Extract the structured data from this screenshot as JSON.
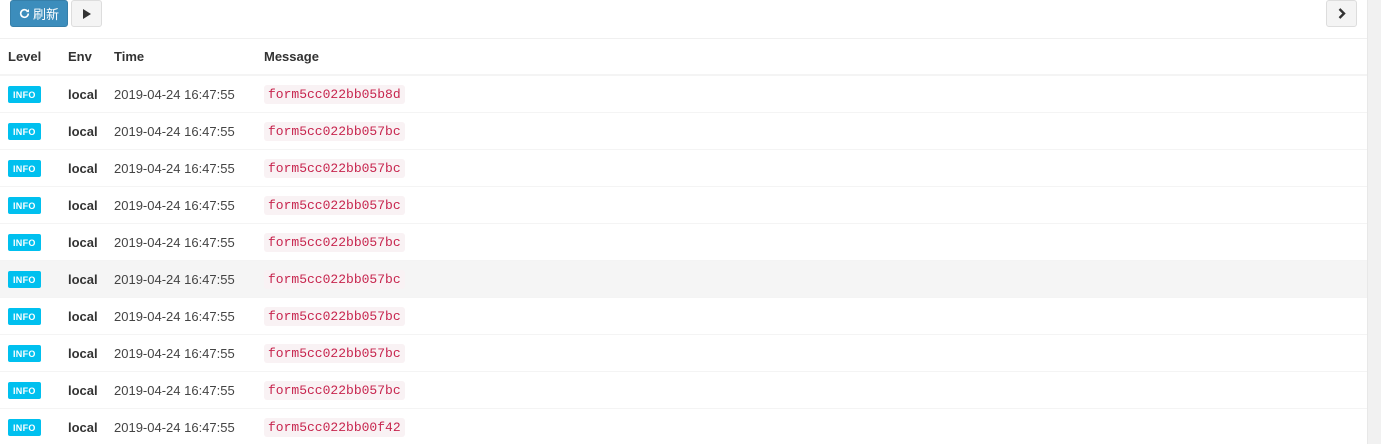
{
  "toolbar": {
    "refresh_label": "刷新",
    "refresh_icon": "refresh-icon",
    "play_icon": "play-icon",
    "next_icon": "chevron-right-icon"
  },
  "colors": {
    "primary": "#3c8dbc",
    "info_badge": "#00c0ef",
    "code_text": "#c7254e",
    "code_bg": "#f9f2f4"
  },
  "table": {
    "headers": {
      "level": "Level",
      "env": "Env",
      "time": "Time",
      "message": "Message"
    },
    "rows": [
      {
        "level": "INFO",
        "env": "local",
        "time": "2019-04-24 16:47:55",
        "message": "form5cc022bb05b8d"
      },
      {
        "level": "INFO",
        "env": "local",
        "time": "2019-04-24 16:47:55",
        "message": "form5cc022bb057bc"
      },
      {
        "level": "INFO",
        "env": "local",
        "time": "2019-04-24 16:47:55",
        "message": "form5cc022bb057bc"
      },
      {
        "level": "INFO",
        "env": "local",
        "time": "2019-04-24 16:47:55",
        "message": "form5cc022bb057bc"
      },
      {
        "level": "INFO",
        "env": "local",
        "time": "2019-04-24 16:47:55",
        "message": "form5cc022bb057bc"
      },
      {
        "level": "INFO",
        "env": "local",
        "time": "2019-04-24 16:47:55",
        "message": "form5cc022bb057bc"
      },
      {
        "level": "INFO",
        "env": "local",
        "time": "2019-04-24 16:47:55",
        "message": "form5cc022bb057bc"
      },
      {
        "level": "INFO",
        "env": "local",
        "time": "2019-04-24 16:47:55",
        "message": "form5cc022bb057bc"
      },
      {
        "level": "INFO",
        "env": "local",
        "time": "2019-04-24 16:47:55",
        "message": "form5cc022bb057bc"
      },
      {
        "level": "INFO",
        "env": "local",
        "time": "2019-04-24 16:47:55",
        "message": "form5cc022bb00f42"
      }
    ]
  }
}
